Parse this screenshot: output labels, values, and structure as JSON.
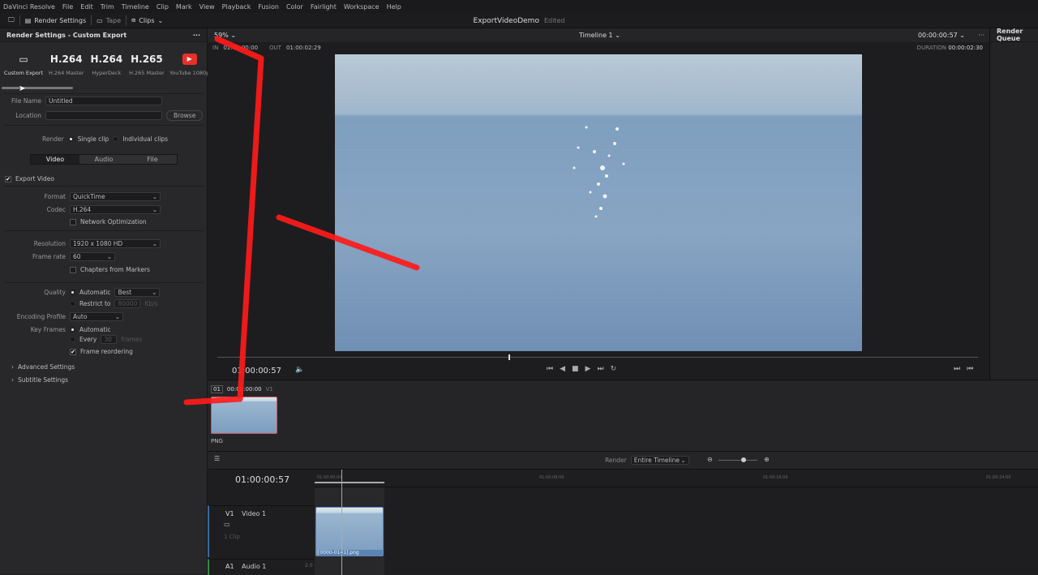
{
  "menu": [
    "DaVinci Resolve",
    "File",
    "Edit",
    "Trim",
    "Timeline",
    "Clip",
    "Mark",
    "View",
    "Playback",
    "Fusion",
    "Color",
    "Fairlight",
    "Workspace",
    "Help"
  ],
  "toolbar": {
    "render_settings": "Render Settings",
    "tape": "Tape",
    "clips": "Clips"
  },
  "project": {
    "name": "ExportVideoDemo",
    "status": "Edited"
  },
  "left_panel": {
    "title": "Render Settings - Custom Export",
    "presets": [
      {
        "big": "",
        "label": "Custom Export"
      },
      {
        "big": "H.264",
        "label": "H.264 Master"
      },
      {
        "big": "H.264",
        "label": "HyperDeck"
      },
      {
        "big": "H.265",
        "label": "H.265 Master"
      },
      {
        "big": "",
        "label": "YouTube 1080p"
      }
    ],
    "file_name_label": "File Name",
    "file_name": "Untitled",
    "location_label": "Location",
    "location": "",
    "browse": "Browse",
    "render_label": "Render",
    "single_clip": "Single clip",
    "individual_clips": "Individual clips",
    "tabs": [
      "Video",
      "Audio",
      "File"
    ],
    "export_video": "Export Video",
    "format_label": "Format",
    "format": "QuickTime",
    "codec_label": "Codec",
    "codec": "H.264",
    "network_opt": "Network Optimization",
    "resolution_label": "Resolution",
    "resolution": "1920 x 1080 HD",
    "frame_rate_label": "Frame rate",
    "frame_rate": "60",
    "chapters": "Chapters from Markers",
    "quality_label": "Quality",
    "automatic": "Automatic",
    "quality": "Best",
    "restrict_to": "Restrict to",
    "restrict_value": "80000",
    "restrict_unit": "Kb/s",
    "encoding_profile_label": "Encoding Profile",
    "encoding_profile": "Auto",
    "key_frames_label": "Key Frames",
    "kf_automatic": "Automatic",
    "kf_every": "Every",
    "kf_value": "30",
    "kf_unit": "frames",
    "frame_reordering": "Frame reordering",
    "advanced": "Advanced Settings",
    "subtitle": "Subtitle Settings"
  },
  "viewer": {
    "zoom": "59%",
    "timeline": "Timeline 1",
    "timecode": "00:00:00:57",
    "in_label": "IN",
    "in": "01:00:00:00",
    "out_label": "OUT",
    "out": "01:00:02:29",
    "duration_label": "DURATION",
    "duration": "00:00:02:30",
    "current": "01:00:00:57"
  },
  "render_queue": {
    "title": "Render Queue"
  },
  "clips": {
    "index": "01",
    "tc": "00:00:00:00",
    "track": "V1",
    "name": "PNG"
  },
  "timeline": {
    "render_label": "Render",
    "render_value": "Entire Timeline",
    "timecode": "01:00:00:57",
    "ruler": [
      "01:00:00:00",
      "01:00:08:00",
      "01:00:16:00",
      "01:00:24:00"
    ],
    "v1": "V1",
    "v1_name": "Video 1",
    "v1_count": "1 Clip",
    "clip_name": "[0000-0141].png",
    "a1": "A1",
    "a1_name": "Audio 1",
    "a1_ch": "2.0"
  },
  "colors": {
    "accent_red": "#ff1a1a",
    "youtube": "#e8302a",
    "clip_selected": "#c85a5a"
  }
}
